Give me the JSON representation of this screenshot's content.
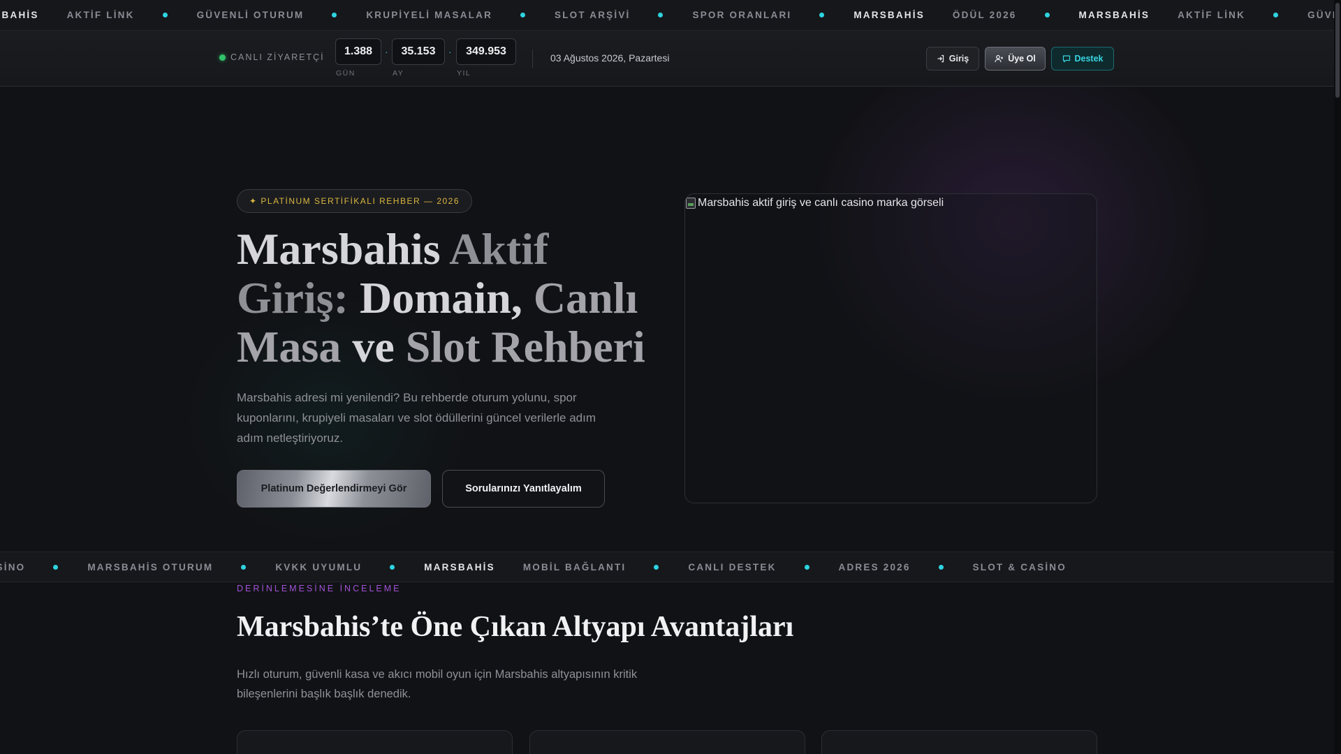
{
  "ticker_top": {
    "items": [
      {
        "text": "MARSBAHİS",
        "bright": true
      },
      {
        "text": "AKTİF LİNK",
        "bright": false
      },
      {
        "dot": true
      },
      {
        "text": "GÜVENLİ OTURUM",
        "bright": false
      },
      {
        "dot": true
      },
      {
        "text": "KRUPİYELİ MASALAR",
        "bright": false
      },
      {
        "dot": true
      },
      {
        "text": "SLOT ARŞİVİ",
        "bright": false
      },
      {
        "dot": true
      },
      {
        "text": "SPOR ORANLARI",
        "bright": false
      },
      {
        "dot": true
      },
      {
        "text": "MARSBAHİS",
        "bright": true
      },
      {
        "text": "ÖDÜL 2026",
        "bright": false
      },
      {
        "dot": true
      },
      {
        "text": "MARSBAHİS",
        "bright": true
      },
      {
        "text": "AKTİF LİNK",
        "bright": false
      },
      {
        "dot": true
      },
      {
        "text": "GÜVENLİ OTURUM",
        "bright": false
      }
    ]
  },
  "header": {
    "live_label": "CANLI ZİYARETÇİ",
    "counters": [
      {
        "value": "1.388",
        "label": "GÜN"
      },
      {
        "value": "35.153",
        "label": "AY"
      },
      {
        "value": "349.953",
        "label": "YIL"
      }
    ],
    "separator": "·",
    "date": "03 Ağustos 2026, Pazartesi",
    "login_label": "Giriş",
    "register_label": "Üye Ol",
    "support_label": "Destek"
  },
  "hero": {
    "badge": "✦ PLATİNUM SERTİFİKALI REHBER — 2026",
    "title_parts": [
      "Marsbahis",
      "Aktif Giriş:",
      "Domain,",
      "Canlı Masa",
      "ve",
      "Slot Rehberi"
    ],
    "description": "Marsbahis adresi mi yenilendi? Bu rehberde oturum yolunu, spor kuponlarını, krupiyeli masaları ve slot ödüllerini güncel verilerle adım adım netleştiriyoruz.",
    "primary_cta": "Platinum Değerlendirmeyi Gör",
    "secondary_cta": "Sorularınızı Yanıtlayalım",
    "image_alt": "Marsbahis aktif giriş ve canlı casino marka görseli"
  },
  "ticker_bottom": {
    "items": [
      {
        "text": "SLOT & CASİNO",
        "bright": false
      },
      {
        "dot": true
      },
      {
        "text": "MARSBAHİS OTURUM",
        "bright": false
      },
      {
        "dot": true
      },
      {
        "text": "KVKK UYUMLU",
        "bright": false
      },
      {
        "dot": true
      },
      {
        "text": "MARSBAHİS",
        "bright": true
      },
      {
        "text": "MOBİL BAĞLANTI",
        "bright": false
      },
      {
        "dot": true
      },
      {
        "text": "CANLI DESTEK",
        "bright": false
      },
      {
        "dot": true
      },
      {
        "text": "ADRES 2026",
        "bright": false
      },
      {
        "dot": true
      },
      {
        "text": "SLOT & CASİNO",
        "bright": false
      }
    ]
  },
  "features": {
    "eyebrow": "DERİNLEMESİNE İNCELEME",
    "title": "Marsbahis’te Öne Çıkan Altyapı Avantajları",
    "description": "Hızlı oturum, güvenli kasa ve akıcı mobil oyun için Marsbahis altyapısının kritik bileşenlerini başlık başlık denedik."
  },
  "colors": {
    "accent_cyan": "#2fd3e0",
    "accent_gold": "#d9b73f",
    "accent_purple": "#a252d8",
    "live_green": "#32c36c"
  }
}
